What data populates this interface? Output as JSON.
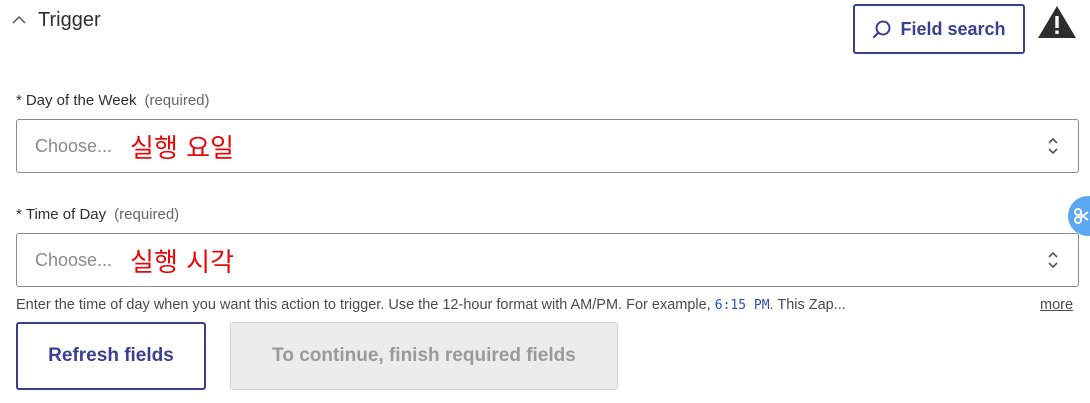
{
  "section": {
    "title": "Trigger",
    "field_search_label": "Field search"
  },
  "fields": [
    {
      "label": "Day of the Week",
      "required_marker": "*",
      "required_text": "(required)",
      "placeholder": "Choose...",
      "annotation": "실행 요일"
    },
    {
      "label": "Time of Day",
      "required_marker": "*",
      "required_text": "(required)",
      "placeholder": "Choose...",
      "annotation": "실행 시각"
    }
  ],
  "helper": {
    "before": "Enter the time of day when you want this action to trigger. Use the 12-hour format with AM/PM. For example, ",
    "code": "6:15 PM",
    "after": ". This Zap...",
    "more": "more"
  },
  "buttons": {
    "refresh": "Refresh fields",
    "continue": "To continue, finish required fields"
  },
  "colors": {
    "accent": "#3b3f8f",
    "annotation": "#e8080a",
    "disabled_bg": "#ececec"
  },
  "icons": {
    "collapse": "chevron-up-icon",
    "search": "search-icon",
    "warning": "warning-icon",
    "select": "updown-icon"
  }
}
